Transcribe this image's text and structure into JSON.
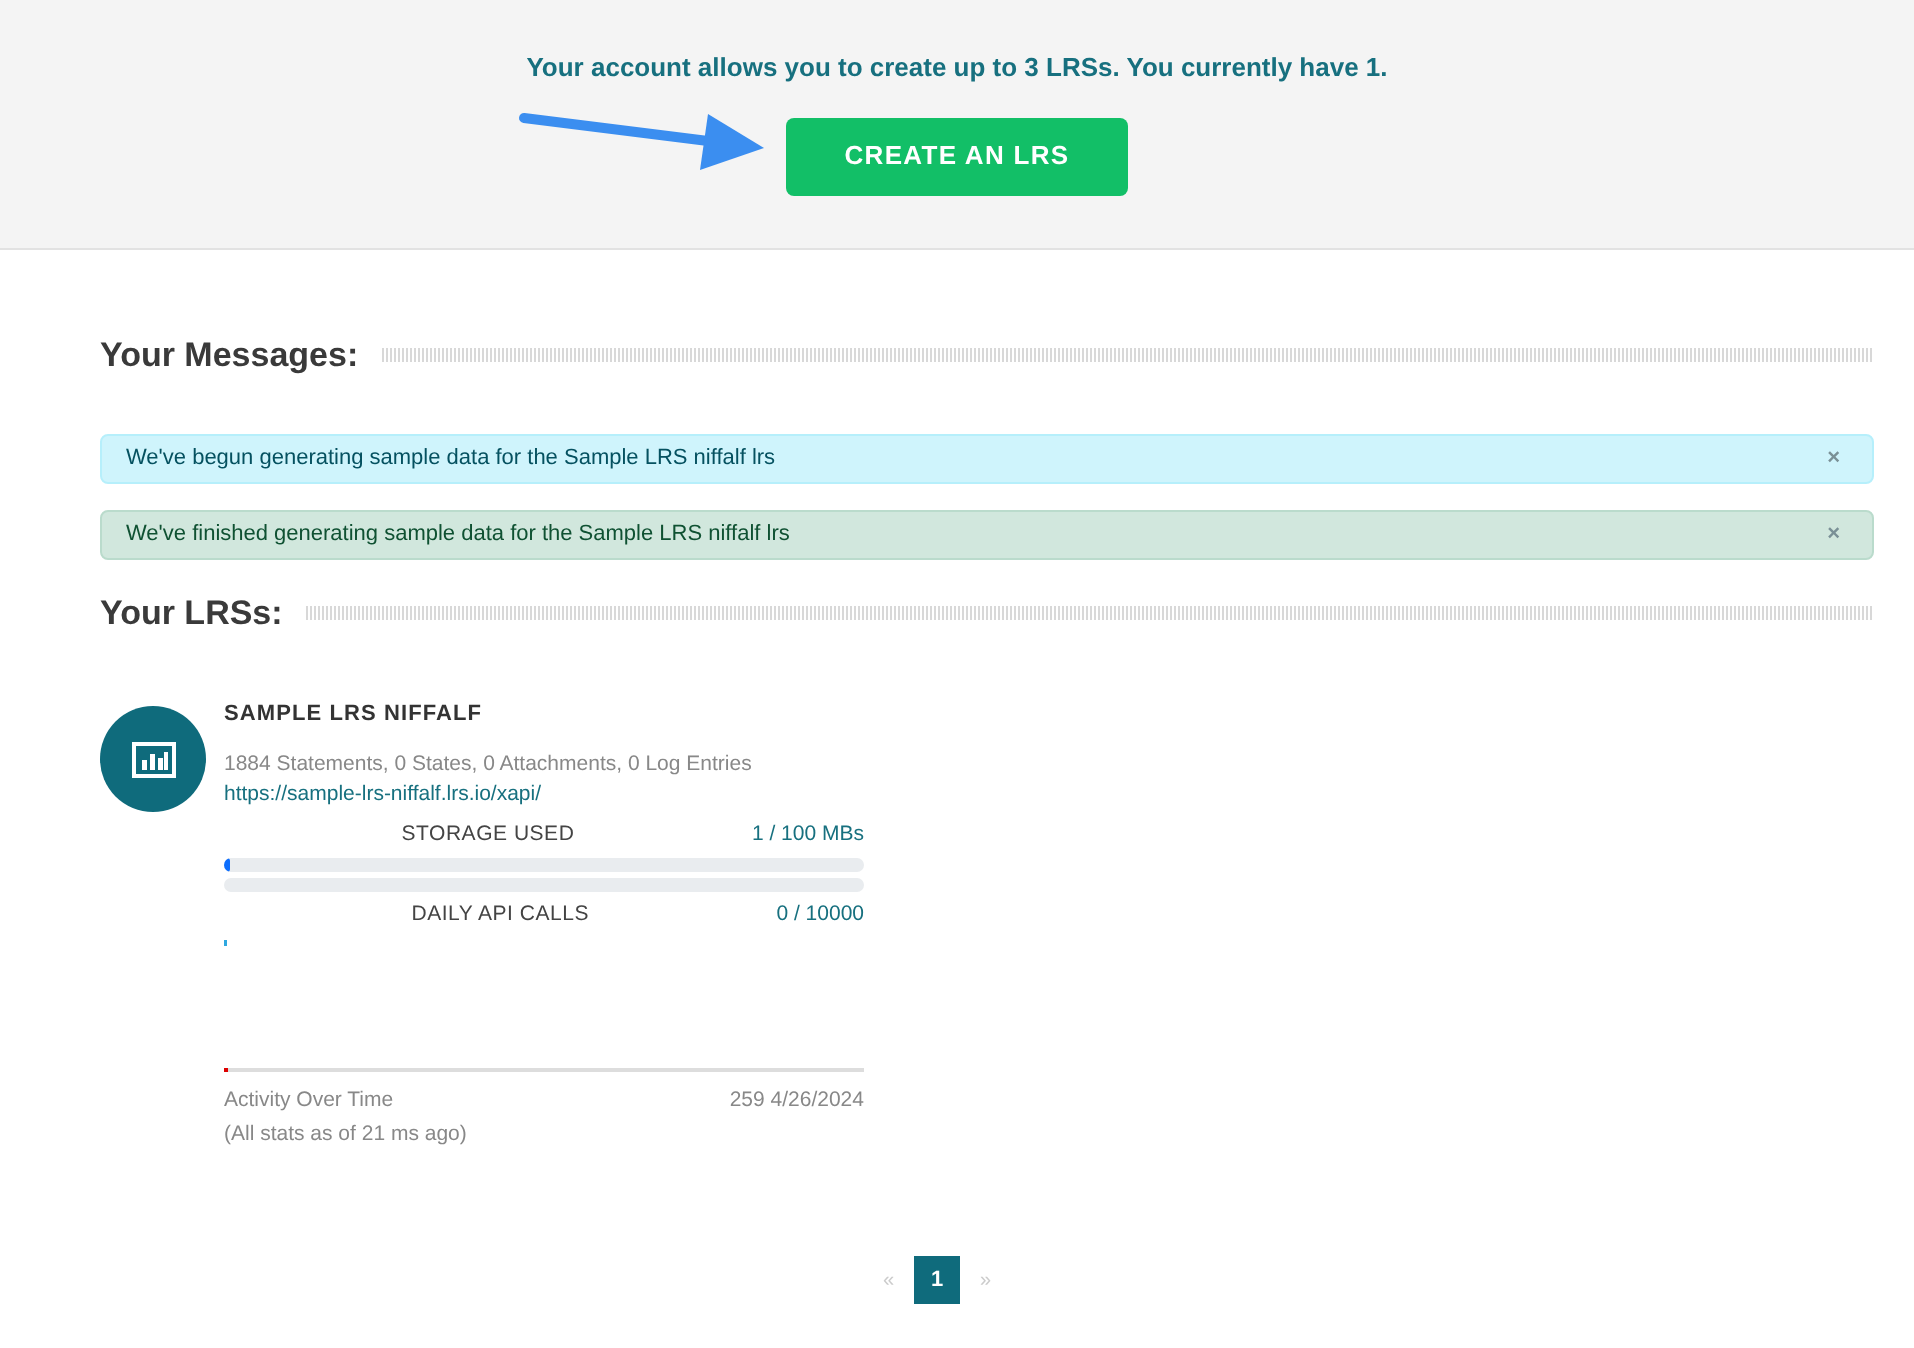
{
  "banner": {
    "text": "Your account allows you to create up to 3 LRSs. You currently have 1.",
    "button": "CREATE AN LRS"
  },
  "messages_section": {
    "title": "Your Messages:",
    "messages": [
      {
        "kind": "info",
        "text": "We've begun generating sample data for the Sample LRS niffalf lrs",
        "close": "×"
      },
      {
        "kind": "success",
        "text": "We've finished generating sample data for the Sample LRS niffalf lrs",
        "close": "×"
      }
    ]
  },
  "lrs_section": {
    "title": "Your LRSs:",
    "lrs": {
      "name": "SAMPLE LRS NIFFALF",
      "stats": "1884 Statements, 0 States, 0 Attachments, 0 Log Entries",
      "url": "https://sample-lrs-niffalf.lrs.io/xapi/",
      "meters": [
        {
          "label": "STORAGE USED",
          "reading": "1 / 100 MBs",
          "level": 0.01
        },
        {
          "label": "DAILY API CALLS",
          "reading": "0 / 10000"
        }
      ],
      "activity_label": "Activity Over Time",
      "activity_reading": "259 4/26/2024",
      "footnote": "(All stats as of 21 ms ago)"
    }
  },
  "pagination": {
    "prev": "«",
    "next": "»",
    "pages": [
      {
        "label": "1",
        "selected": true
      }
    ]
  }
}
